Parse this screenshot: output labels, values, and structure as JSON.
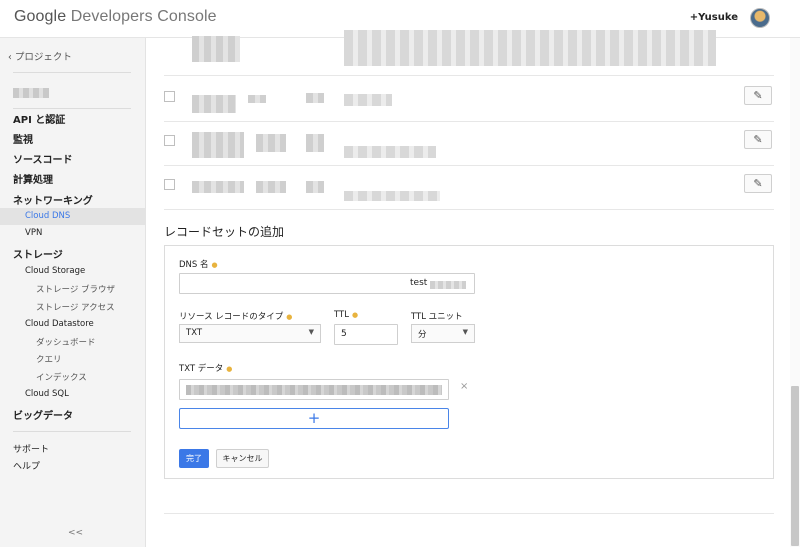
{
  "header": {
    "app_title_brand": "Google",
    "app_title_product": "Developers Console",
    "user_name": "+Yusuke"
  },
  "sidebar": {
    "back_label": "プロジェクト",
    "items": [
      {
        "label": "API と認証"
      },
      {
        "label": "監視"
      },
      {
        "label": "ソースコード"
      },
      {
        "label": "計算処理"
      },
      {
        "label": "ネットワーキング"
      }
    ],
    "networking_sub": [
      {
        "label": "Cloud DNS",
        "active": true
      },
      {
        "label": "VPN"
      }
    ],
    "storage": {
      "label": "ストレージ",
      "sub": [
        {
          "label": "Cloud Storage"
        },
        {
          "label": "Cloud Datastore"
        },
        {
          "label": "Cloud SQL"
        }
      ],
      "cloud_storage_children": [
        {
          "label": "ストレージ ブラウザ"
        },
        {
          "label": "ストレージ アクセス"
        }
      ],
      "datastore_children": [
        {
          "label": "ダッシュボード"
        },
        {
          "label": "クエリ"
        },
        {
          "label": "インデックス"
        }
      ]
    },
    "bigdata_label": "ビッグデータ",
    "support_label": "サポート",
    "help_label": "ヘルプ",
    "collapse_label": "<<"
  },
  "main": {
    "section_title": "レコードセットの追加",
    "form": {
      "dns_name_label": "DNS 名",
      "dns_name_value": "test",
      "record_type_label": "リソース レコードのタイプ",
      "record_type_value": "TXT",
      "ttl_label": "TTL",
      "ttl_value": "5",
      "ttl_unit_label": "TTL ユニット",
      "ttl_unit_value": "分",
      "txt_data_label": "TXT データ",
      "add_symbol": "+",
      "remove_symbol": "×",
      "done_label": "完了",
      "cancel_label": "キャンセル"
    },
    "edit_icon_glyph": "✎"
  },
  "colors": {
    "accent": "#3b78e7",
    "required_dot": "#e8b33e"
  }
}
